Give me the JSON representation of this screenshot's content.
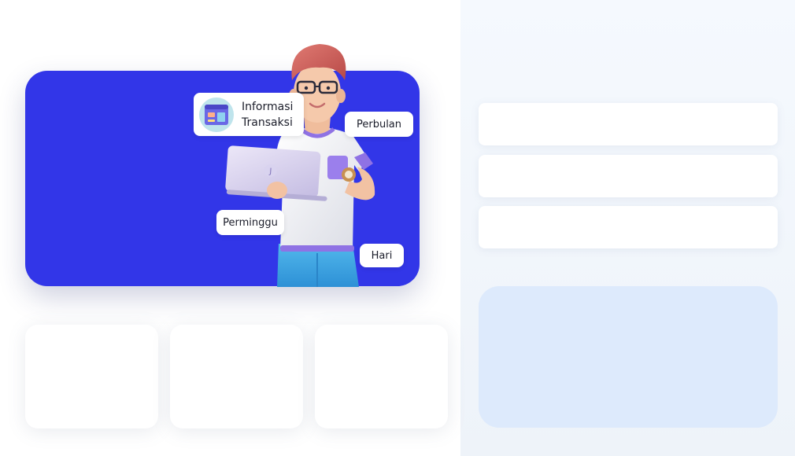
{
  "hero": {
    "chips": {
      "info_line1": "Informasi",
      "info_line2": "Transaksi",
      "month": "Perbulan",
      "week": "Perminggu",
      "day": "Hari"
    }
  },
  "colors": {
    "hero_blue": "#3236e8",
    "panel_bg": "#f2f6fb",
    "info_card": "#ddeafc"
  },
  "icons": {
    "transaction": "transaction-dashboard-icon",
    "laptop_logo": "laptop-logo-icon"
  }
}
